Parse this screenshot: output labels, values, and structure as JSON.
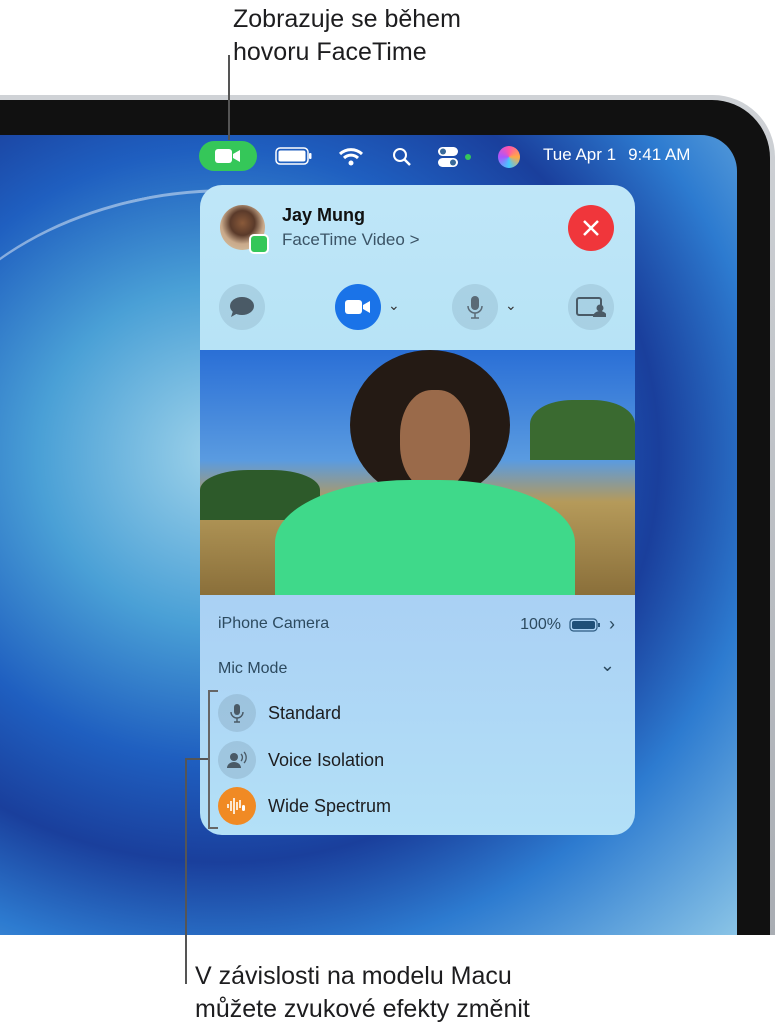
{
  "callouts": {
    "top": [
      "Zobrazuje se během",
      "hovoru FaceTime"
    ],
    "bottom": [
      "V závislosti na modelu Macu",
      "můžete zvukové efekty změnit"
    ]
  },
  "menubar": {
    "date": "Tue Apr 1",
    "time": "9:41 AM",
    "icons": [
      "facetime-video-icon",
      "battery-icon",
      "wifi-icon",
      "search-icon",
      "control-center-icon",
      "siri-icon"
    ]
  },
  "call": {
    "name": "Jay Mung",
    "subtitle": "FaceTime Video",
    "chevron": ">"
  },
  "controls": [
    "message-icon",
    "video-camera-icon",
    "microphone-icon",
    "screen-share-icon"
  ],
  "camera": {
    "label": "iPhone Camera",
    "battery": "100%"
  },
  "mic_mode": {
    "label": "Mic Mode",
    "options": [
      {
        "label": "Standard",
        "selected": false
      },
      {
        "label": "Voice Isolation",
        "selected": false
      },
      {
        "label": "Wide Spectrum",
        "selected": true
      }
    ]
  },
  "colors": {
    "accent": "#1a73e8",
    "end": "#f0363b",
    "green": "#35c759",
    "orange": "#f08a24"
  }
}
